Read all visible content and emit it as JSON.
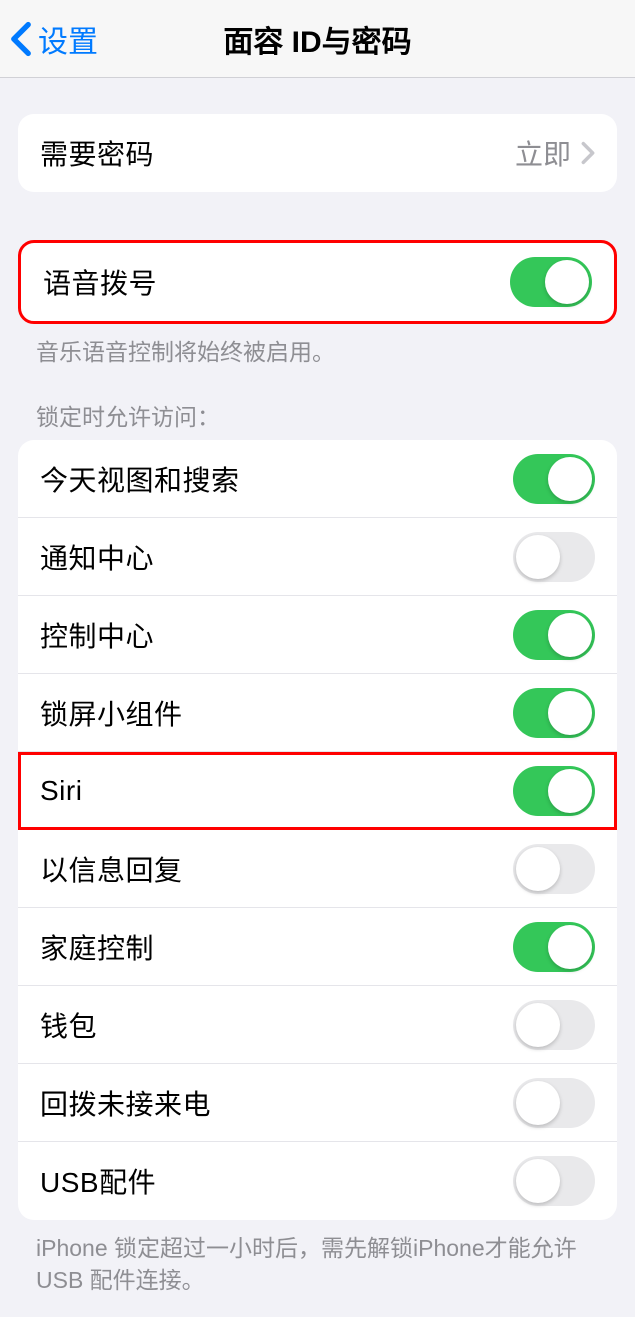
{
  "nav": {
    "back_label": "设置",
    "title": "面容 ID与密码"
  },
  "require_passcode": {
    "label": "需要密码",
    "value": "立即"
  },
  "voice_dial": {
    "label": "语音拨号",
    "on": true
  },
  "voice_dial_footer": "音乐语音控制将始终被启用。",
  "lock_access_header": "锁定时允许访问：",
  "lock_access_items": [
    {
      "label": "今天视图和搜索",
      "on": true
    },
    {
      "label": "通知中心",
      "on": false
    },
    {
      "label": "控制中心",
      "on": true
    },
    {
      "label": "锁屏小组件",
      "on": true
    },
    {
      "label": "Siri",
      "on": true
    },
    {
      "label": "以信息回复",
      "on": false
    },
    {
      "label": "家庭控制",
      "on": true
    },
    {
      "label": "钱包",
      "on": false
    },
    {
      "label": "回拨未接来电",
      "on": false
    },
    {
      "label": "USB配件",
      "on": false
    }
  ],
  "usb_footer": "iPhone 锁定超过一小时后，需先解锁iPhone才能允许USB 配件连接。"
}
